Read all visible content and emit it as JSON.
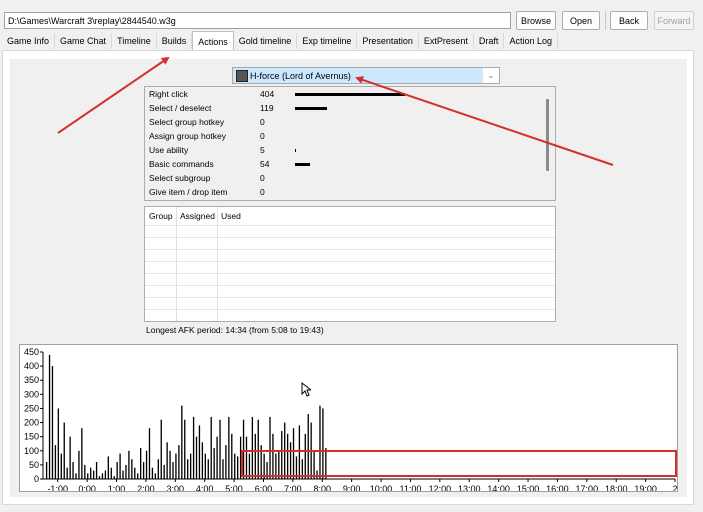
{
  "toolbar": {
    "path_value": "D:\\Games\\Warcraft 3\\replay\\2844540.w3g",
    "browse_label": "Browse",
    "open_label": "Open",
    "back_label": "Back",
    "forward_label": "Forward"
  },
  "tabs": [
    {
      "label": "Game Info"
    },
    {
      "label": "Game Chat"
    },
    {
      "label": "Timeline"
    },
    {
      "label": "Builds"
    },
    {
      "label": "Actions",
      "active": true
    },
    {
      "label": "Gold timeline"
    },
    {
      "label": "Exp timeline"
    },
    {
      "label": "Presentation"
    },
    {
      "label": "ExtPresent"
    },
    {
      "label": "Draft"
    },
    {
      "label": "Action Log"
    }
  ],
  "player_select": {
    "selected": "H-force (Lord of Avernus)",
    "icon": "hero-portrait-icon"
  },
  "actions": [
    {
      "name": "Right click",
      "count": 404
    },
    {
      "name": "Select / deselect",
      "count": 119
    },
    {
      "name": "Select group hotkey",
      "count": 0
    },
    {
      "name": "Assign group hotkey",
      "count": 0
    },
    {
      "name": "Use ability",
      "count": 5
    },
    {
      "name": "Basic commands",
      "count": 54
    },
    {
      "name": "Select subgroup",
      "count": 0
    },
    {
      "name": "Give item / drop item",
      "count": 0
    }
  ],
  "groups": {
    "headers": [
      "Group",
      "Assigned",
      "Used"
    ],
    "rows": []
  },
  "afk_text": "Longest AFK period: 14:34 (from 5:08 to 19:43)",
  "annotation_colors": {
    "arrow": "#d32f2f",
    "highlight_box": "#d32f2f"
  },
  "chart_data": {
    "type": "bar",
    "title": "",
    "xlabel": "",
    "ylabel": "",
    "ylim": [
      0,
      450
    ],
    "xlim_minutes": [
      -1.5,
      20
    ],
    "y_ticks": [
      "450",
      "400",
      "350",
      "300",
      "250",
      "200",
      "150",
      "100",
      "50",
      "0"
    ],
    "x_ticks": [
      "-1:00",
      "0:00",
      "1:00",
      "2:00",
      "3:00",
      "4:00",
      "5:00",
      "6:00",
      "7:00",
      "8:00",
      "9:00",
      "10:00",
      "11:00",
      "12:00",
      "13:00",
      "14:00",
      "15:00",
      "16:00",
      "17:00",
      "18:00",
      "19:00",
      "2"
    ],
    "bin_minutes": 0.1,
    "start_minute": -1.4,
    "values": [
      60,
      440,
      400,
      120,
      250,
      90,
      200,
      40,
      150,
      60,
      20,
      100,
      180,
      50,
      20,
      40,
      30,
      60,
      10,
      20,
      30,
      80,
      40,
      10,
      60,
      90,
      30,
      50,
      100,
      70,
      40,
      20,
      110,
      60,
      100,
      180,
      40,
      20,
      70,
      210,
      50,
      130,
      100,
      60,
      90,
      120,
      260,
      210,
      70,
      90,
      220,
      150,
      190,
      130,
      90,
      70,
      220,
      110,
      150,
      210,
      70,
      120,
      220,
      160,
      90,
      80,
      150,
      210,
      150,
      90,
      220,
      160,
      210,
      120,
      90,
      60,
      220,
      160,
      90,
      100,
      170,
      200,
      160,
      130,
      180,
      80,
      190,
      70,
      160,
      230,
      200,
      100,
      30,
      260,
      250,
      110
    ]
  }
}
